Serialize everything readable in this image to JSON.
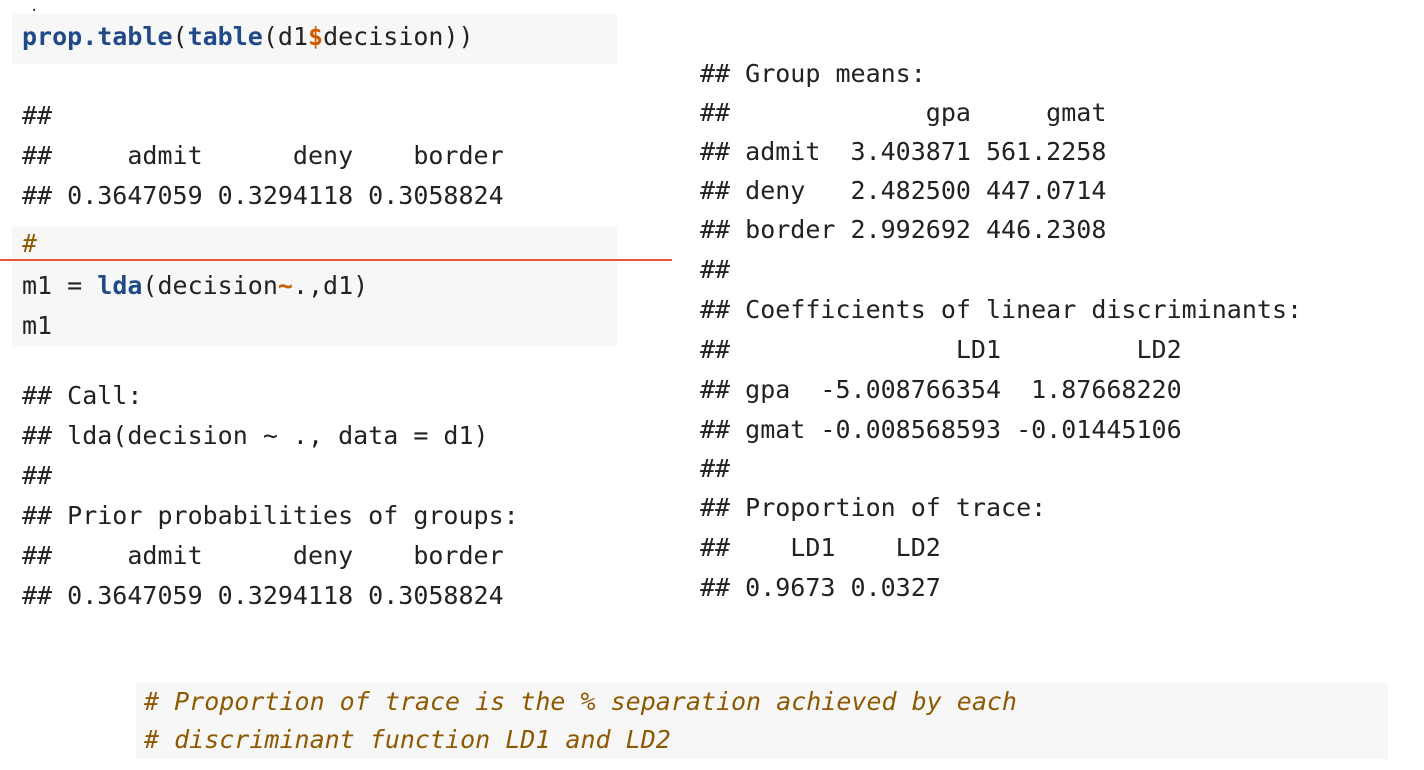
{
  "top_dot": ".",
  "left_panel": {
    "chunk1": {
      "fn1": "prop.table",
      "p1": "(",
      "fn2": "table",
      "arg_before": "(d1",
      "dollar": "$",
      "arg_after": "decision))"
    },
    "out1": [
      "##",
      "##     admit      deny    border",
      "## 0.3647059 0.3294118 0.3058824"
    ],
    "chunk2_comment": "#",
    "chunk2_line1": {
      "lhs": "m1 = ",
      "fn": "lda",
      "before_tilde": "(decision",
      "tilde": "~",
      "after_tilde": ".,d1)"
    },
    "chunk2_line2": "m1",
    "out2": [
      "## Call:",
      "## lda(decision ~ ., data = d1)",
      "##",
      "## Prior probabilities of groups:",
      "##     admit      deny    border",
      "## 0.3647059 0.3294118 0.3058824"
    ]
  },
  "right_panel": {
    "out": [
      "## Group means:",
      "##             gpa     gmat",
      "## admit  3.403871 561.2258",
      "## deny   2.482500 447.0714",
      "## border 2.992692 446.2308",
      "##",
      "## Coefficients of linear discriminants:",
      "##               LD1         LD2",
      "## gpa  -5.008766354  1.87668220",
      "## gmat -0.008568593 -0.01445106",
      "##",
      "## Proportion of trace:",
      "##    LD1    LD2",
      "## 0.9673 0.0327"
    ]
  },
  "bottom_comment": [
    "# Proportion of trace is the % separation achieved by each",
    "# discriminant function LD1 and LD2"
  ],
  "colors": {
    "function": "#204a87",
    "operator": "#ce5c00",
    "comment": "#8f5902",
    "chunk_background": "#f7f7f7",
    "annotation_line": "#e8553a"
  }
}
